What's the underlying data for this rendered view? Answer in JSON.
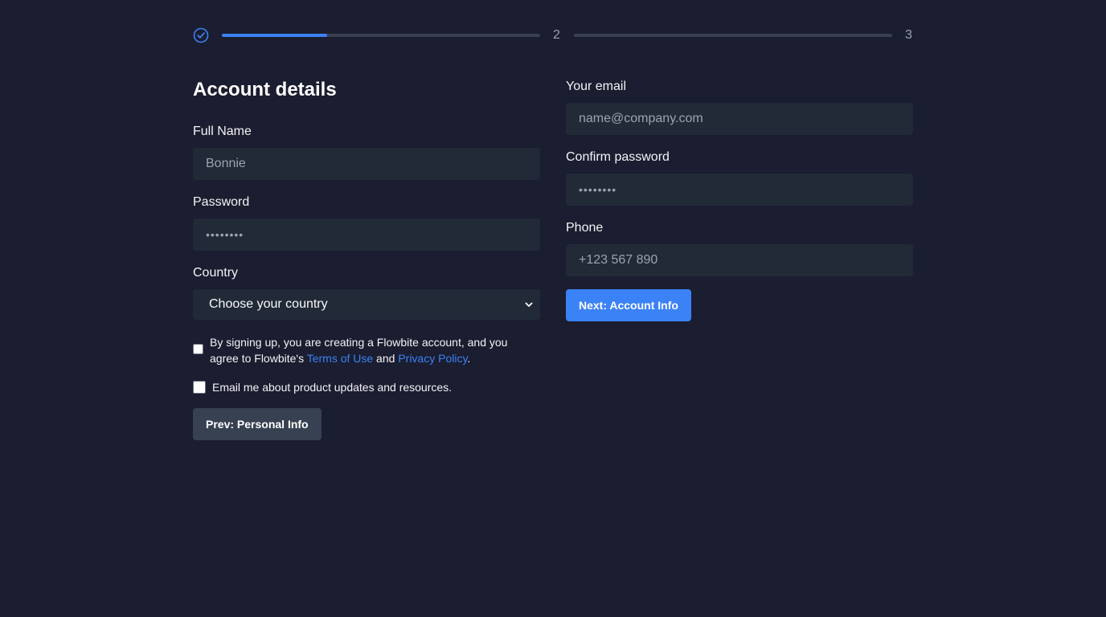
{
  "stepper": {
    "step1_icon": "check-circle-icon",
    "step1_progress": 0.33,
    "step2_number": "2",
    "step3_number": "3",
    "accent": "#3b82f6"
  },
  "form": {
    "title": "Account details",
    "full_name": {
      "label": "Full Name",
      "placeholder": "Bonnie"
    },
    "password": {
      "label": "Password",
      "value": "••••••••"
    },
    "country": {
      "label": "Country",
      "selected": "Choose your country"
    },
    "terms": {
      "text_before": "By signing up, you are creating a Flowbite account, and you agree to Flowbite's ",
      "terms_link": "Terms of Use",
      "text_middle": " and ",
      "privacy_link": "Privacy Policy",
      "text_after": "."
    },
    "newsletter": {
      "label": "Email me about product updates and resources."
    },
    "prev_button": "Prev: Personal Info",
    "email": {
      "label": "Your email",
      "placeholder": "name@company.com"
    },
    "confirm_password": {
      "label": "Confirm password",
      "value": "••••••••"
    },
    "phone": {
      "label": "Phone",
      "placeholder": "+123 567 890"
    },
    "next_button": "Next: Account Info"
  }
}
